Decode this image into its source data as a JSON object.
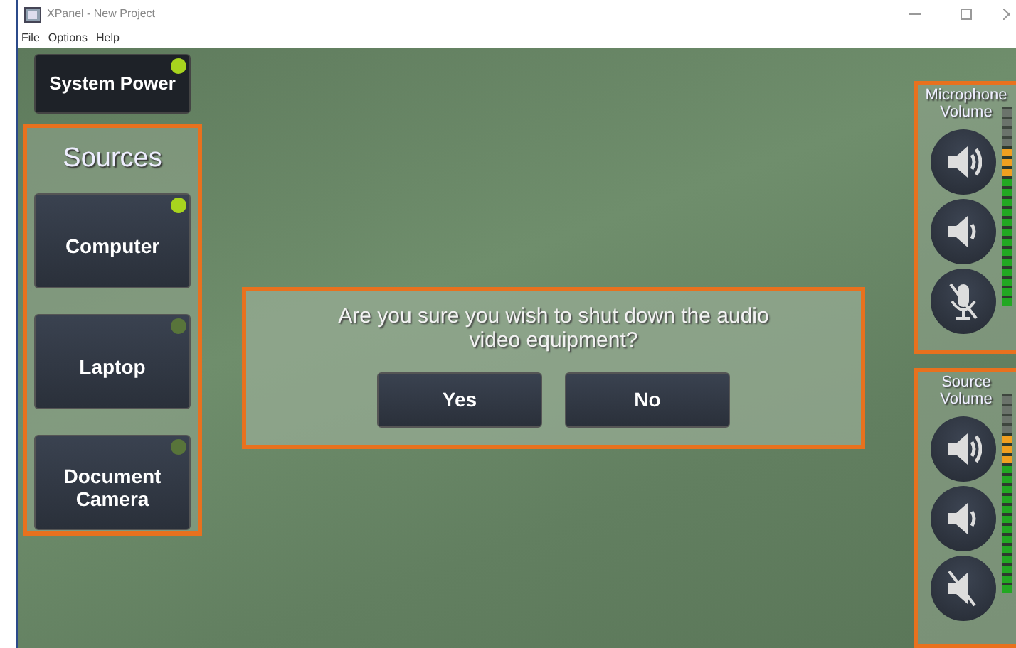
{
  "window": {
    "title": "XPanel - New Project"
  },
  "menu": [
    "File",
    "Options",
    "Help"
  ],
  "system_power": {
    "label": "System Power",
    "on": true
  },
  "sources": {
    "title": "Sources",
    "items": [
      {
        "label": "Computer",
        "selected": true
      },
      {
        "label": "Laptop",
        "selected": false
      },
      {
        "label": "Document Camera",
        "selected": false
      }
    ]
  },
  "dialog": {
    "message": "Are you sure you wish to shut down the audio video equipment?",
    "buttons": [
      "Yes",
      "No"
    ]
  },
  "volume_panels": [
    {
      "title": "Microphone Volume",
      "kind": "microphone",
      "level": 0.8
    },
    {
      "title": "Source Volume",
      "kind": "source",
      "level": 0.8
    }
  ]
}
